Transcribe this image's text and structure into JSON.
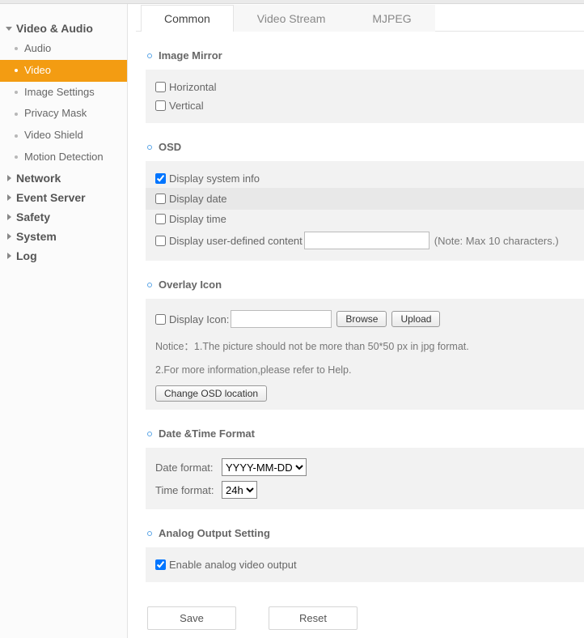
{
  "sidebar": {
    "groups": [
      {
        "label": "Video & Audio",
        "expanded": true,
        "items": [
          {
            "label": "Audio",
            "active": false
          },
          {
            "label": "Video",
            "active": true
          },
          {
            "label": "Image Settings",
            "active": false
          },
          {
            "label": "Privacy Mask",
            "active": false
          },
          {
            "label": "Video Shield",
            "active": false
          },
          {
            "label": "Motion Detection",
            "active": false
          }
        ]
      },
      {
        "label": "Network",
        "expanded": false
      },
      {
        "label": "Event Server",
        "expanded": false
      },
      {
        "label": "Safety",
        "expanded": false
      },
      {
        "label": "System",
        "expanded": false
      },
      {
        "label": "Log",
        "expanded": false
      }
    ]
  },
  "tabs": [
    {
      "label": "Common",
      "active": true
    },
    {
      "label": "Video Stream",
      "active": false
    },
    {
      "label": "MJPEG",
      "active": false
    }
  ],
  "image_mirror": {
    "title": "Image Mirror",
    "horizontal": {
      "label": "Horizontal",
      "checked": false
    },
    "vertical": {
      "label": "Vertical",
      "checked": false
    }
  },
  "osd": {
    "title": "OSD",
    "system_info": {
      "label": "Display system info",
      "checked": true
    },
    "date": {
      "label": "Display date",
      "checked": false
    },
    "time": {
      "label": "Display time",
      "checked": false
    },
    "user_defined": {
      "label": "Display user-defined content",
      "checked": false,
      "value": "",
      "note": "(Note: Max 10 characters.)"
    }
  },
  "overlay": {
    "title": "Overlay Icon",
    "display_icon": {
      "label": "Display Icon:",
      "checked": false,
      "value": ""
    },
    "browse": "Browse",
    "upload": "Upload",
    "notice1": "Notice：1.The picture should not be more than 50*50 px in jpg format.",
    "notice2": "2.For more information,please refer to Help.",
    "change_osd": "Change OSD location"
  },
  "dt": {
    "title": "Date &Time Format",
    "date_label": "Date format:",
    "date_value": "YYYY-MM-DD",
    "date_options": [
      "YYYY-MM-DD"
    ],
    "time_label": "Time format:",
    "time_value": "24h",
    "time_options": [
      "24h"
    ]
  },
  "analog": {
    "title": "Analog Output Setting",
    "enable": {
      "label": "Enable analog video output",
      "checked": true
    }
  },
  "footer": {
    "save": "Save",
    "reset": "Reset"
  }
}
